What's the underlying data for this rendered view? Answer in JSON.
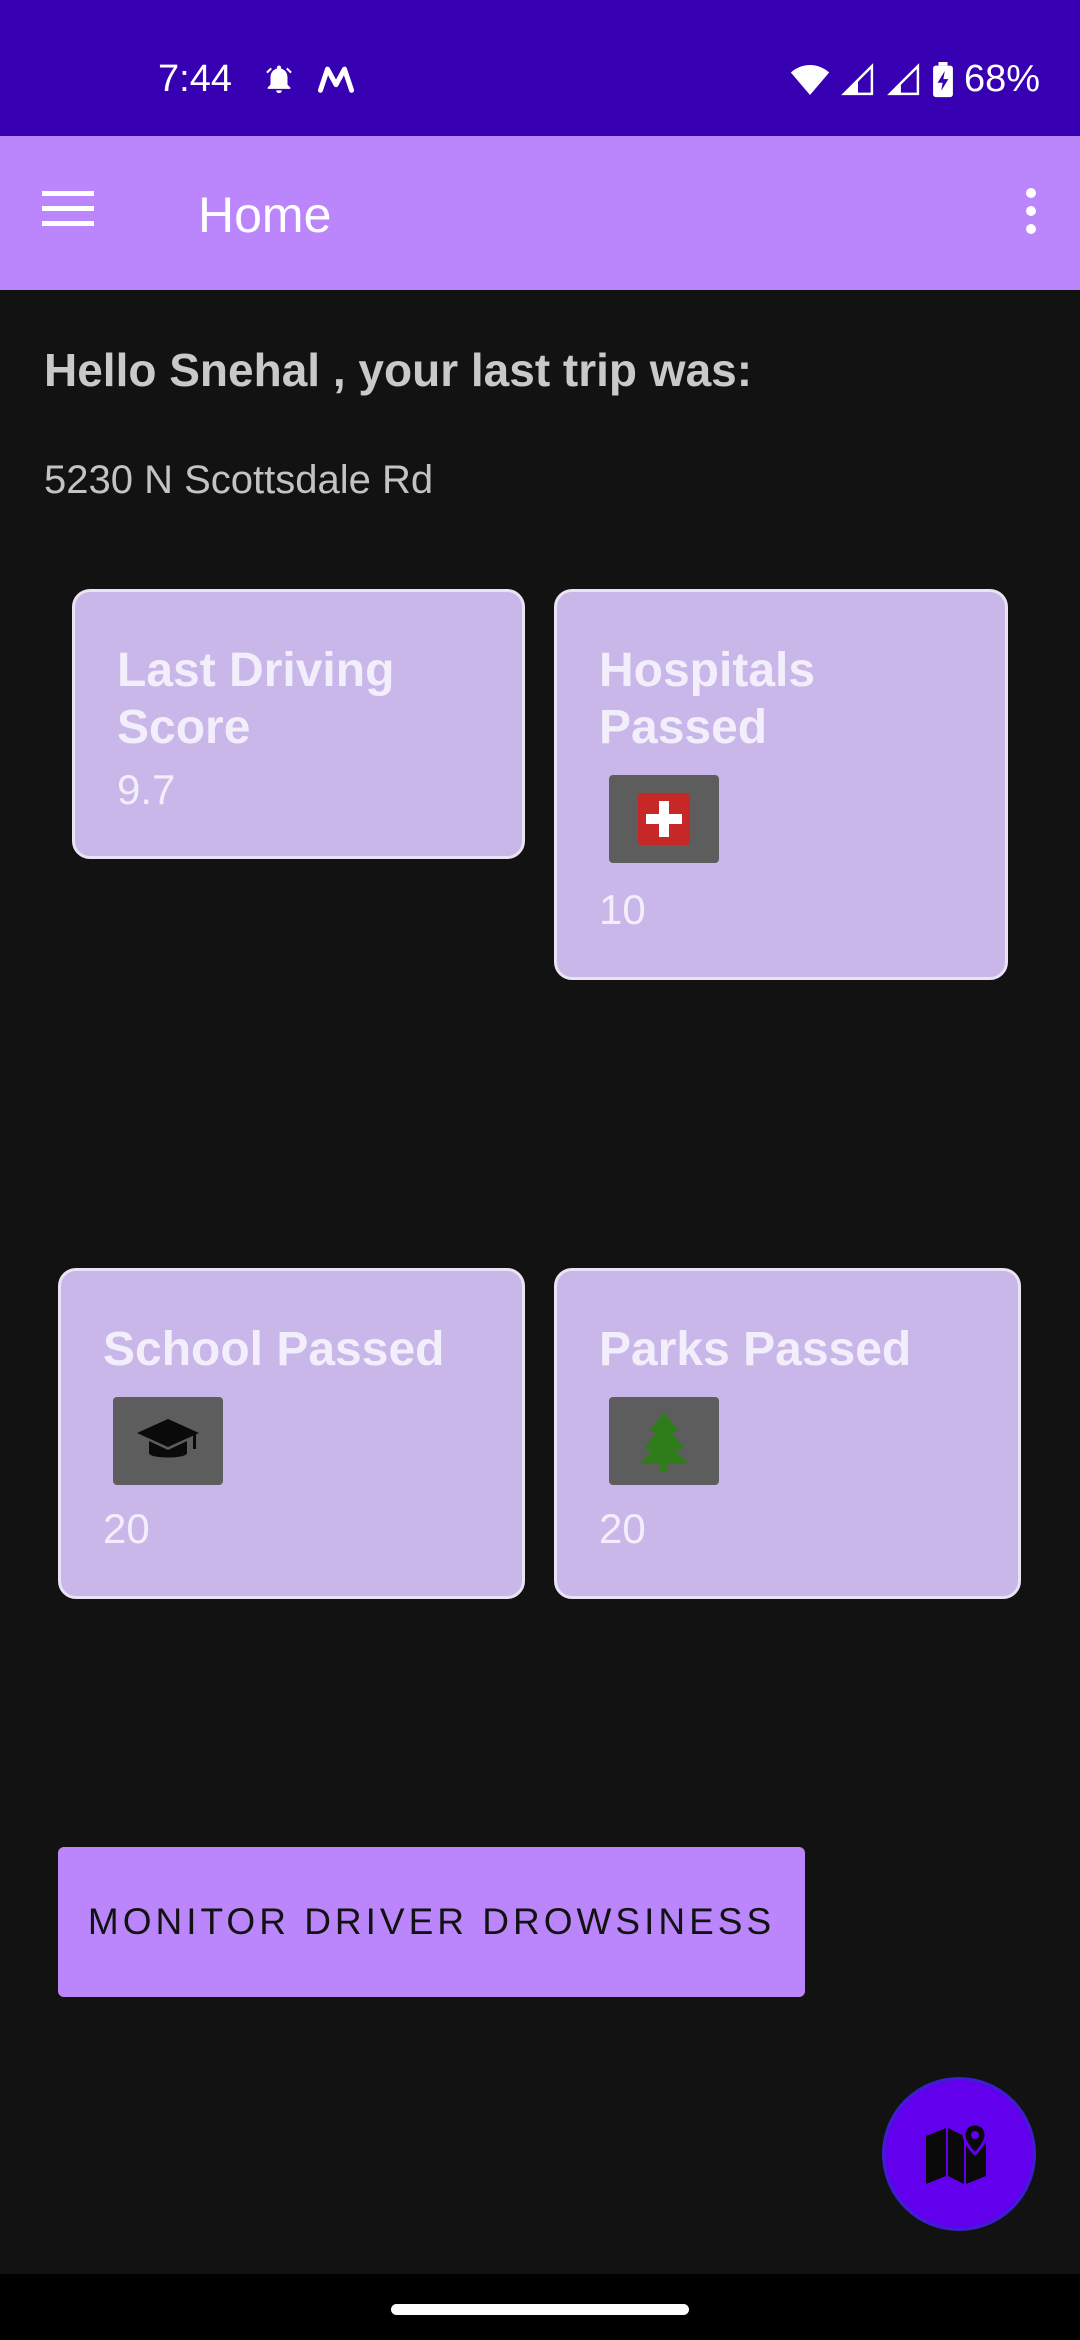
{
  "status_bar": {
    "time": "7:44",
    "battery": "68%",
    "icons": [
      "alarm-icon",
      "app-m-icon",
      "wifi-icon",
      "signal-icon",
      "signal-icon",
      "battery-charging-icon"
    ]
  },
  "app_bar": {
    "title": "Home",
    "menu_icon": "hamburger-menu-icon",
    "overflow_icon": "more-vert-icon"
  },
  "greeting": "Hello Snehal , your last trip was:",
  "trip_location": "5230 N Scottsdale Rd",
  "cards": {
    "driving_score": {
      "title_line1": "Last Driving",
      "title_line2": "Score",
      "value": "9.7"
    },
    "hospitals": {
      "title_line1": "Hospitals",
      "title_line2": "Passed",
      "value": "10",
      "icon": "hospital-icon"
    },
    "school": {
      "title": "School Passed",
      "value": "20",
      "icon": "graduation-cap-icon"
    },
    "parks": {
      "title": "Parks Passed",
      "value": "20",
      "icon": "tree-icon"
    }
  },
  "monitor_button": {
    "label": "MONITOR DRIVER DROWSINESS"
  },
  "fab": {
    "icon": "map-pin-icon"
  },
  "colors": {
    "status_bar": "#3700b3",
    "app_bar": "#bb86fc",
    "background": "#121212",
    "card": "#c8b7e8",
    "fab": "#6200ee",
    "hospital_red": "#c62828",
    "tree_green": "#2e7d1a"
  }
}
